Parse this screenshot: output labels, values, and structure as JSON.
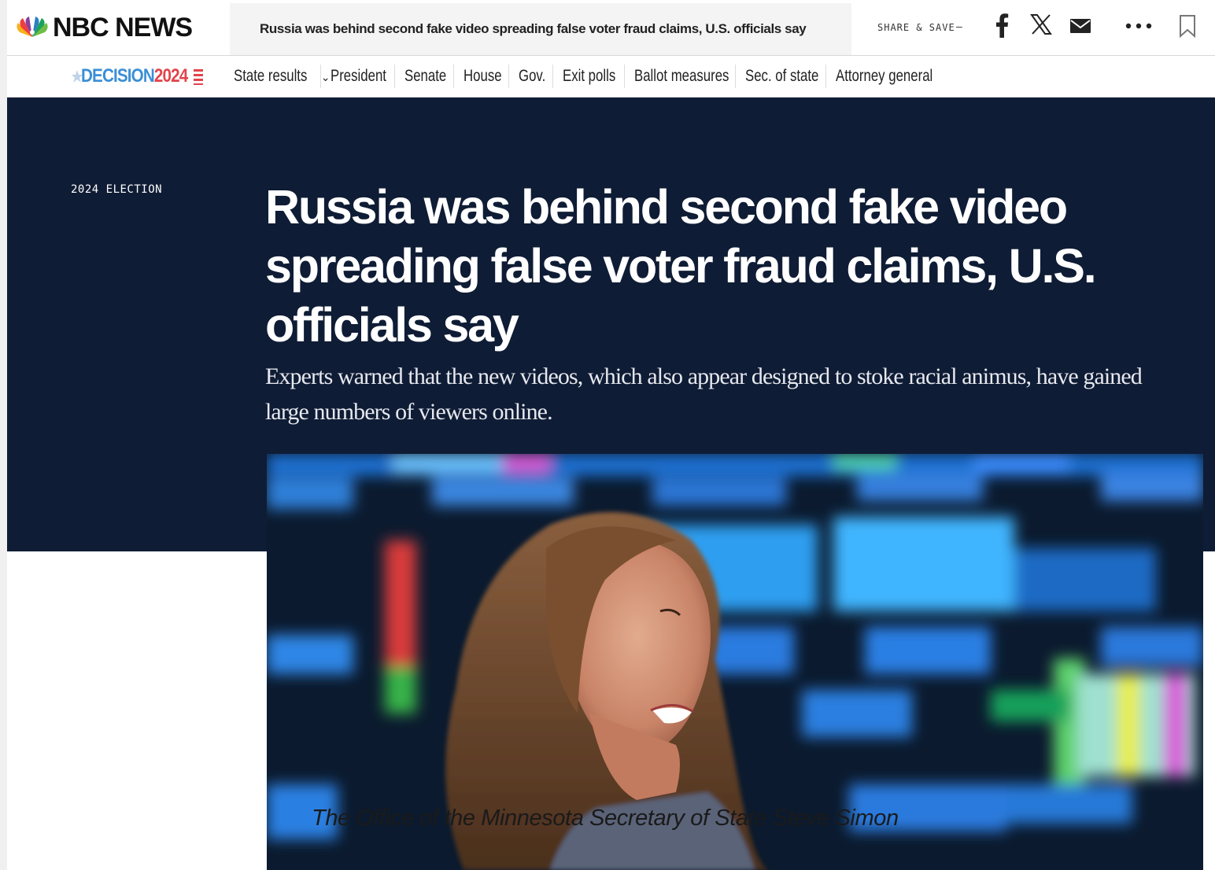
{
  "brand": {
    "name": "NBC NEWS"
  },
  "topbar": {
    "article_title": "Russia was behind second fake video spreading false voter fraud claims, U.S. officials say",
    "share_label": "SHARE & SAVE",
    "share_dash": "–"
  },
  "icons": {
    "facebook": "facebook-icon",
    "x": "x-icon",
    "email": "email-icon",
    "more": "more-icon",
    "bookmark": "bookmark-icon"
  },
  "decision": {
    "label": "DECISION",
    "year": "2024",
    "nav": [
      {
        "label": "State results",
        "has_dropdown": true
      },
      {
        "label": "President"
      },
      {
        "label": "Senate"
      },
      {
        "label": "House"
      },
      {
        "label": "Gov."
      },
      {
        "label": "Exit polls"
      },
      {
        "label": "Ballot measures"
      },
      {
        "label": "Sec. of state"
      },
      {
        "label": "Attorney general"
      }
    ]
  },
  "article": {
    "kicker": "2024 ELECTION",
    "headline": "Russia was behind second fake video spreading false voter fraud claims, U.S. officials say",
    "dek": "Experts warned that the new videos, which also appear designed to stoke racial animus, have gained large numbers of viewers online.",
    "image_caption": "The Office of the Minnesota Secretary of State Steve Simon"
  },
  "colors": {
    "hero_bg": "#0f1c35",
    "decision_blue": "#3b8fd6",
    "decision_red": "#e2434b"
  }
}
